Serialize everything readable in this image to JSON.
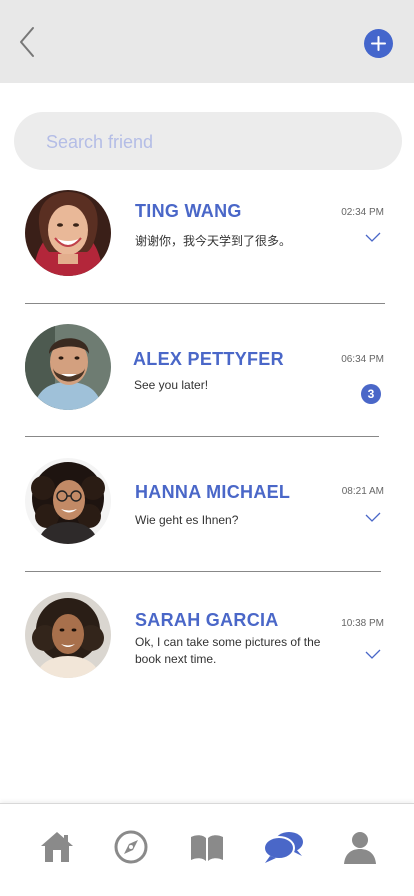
{
  "header": {
    "back_icon": "chevron-left-icon",
    "add_icon": "plus-icon",
    "accent_color": "#4466cc"
  },
  "search": {
    "placeholder": "Search friend",
    "value": ""
  },
  "chats": [
    {
      "name": "TING WANG",
      "time": "02:34 PM",
      "message": "谢谢你，我今天学到了很多。",
      "status": "read-check"
    },
    {
      "name": "ALEX PETTYFER",
      "time": "06:34 PM",
      "message": "See you later!",
      "unread_count": "3"
    },
    {
      "name": "HANNA MICHAEL",
      "time": "08:21 AM",
      "message": "Wie geht es Ihnen?",
      "status": "read-check"
    },
    {
      "name": "SARAH GARCIA",
      "time": "10:38 PM",
      "message": "Ok, I can take some pictures of the book next time.",
      "status": "read-check"
    }
  ],
  "bottom_nav": {
    "items": [
      {
        "icon": "home-icon",
        "active": false
      },
      {
        "icon": "compass-icon",
        "active": false
      },
      {
        "icon": "book-icon",
        "active": false
      },
      {
        "icon": "chat-bubbles-icon",
        "active": true
      },
      {
        "icon": "user-icon",
        "active": false
      }
    ],
    "active_color": "#4a67c8",
    "inactive_color": "#8a8a8a"
  },
  "colors": {
    "name": "#4a67c8",
    "header_bg": "#e8e8e8",
    "search_bg": "#ececec",
    "placeholder": "#b4bde6"
  }
}
